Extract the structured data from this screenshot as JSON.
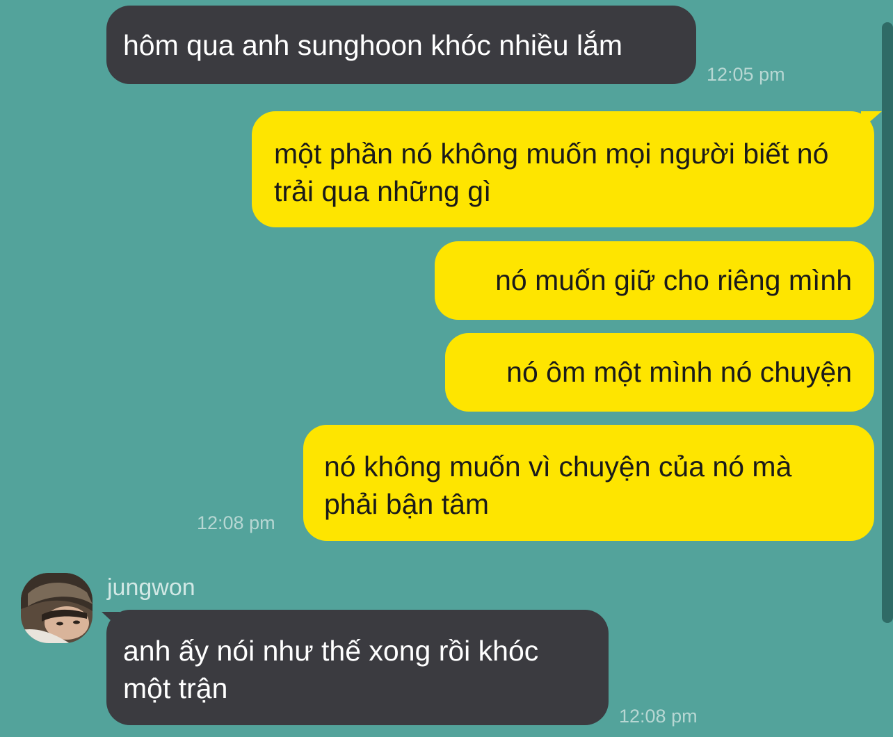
{
  "messages": [
    {
      "text": "hôm qua anh sunghoon khóc nhiều lắm",
      "side": "received",
      "time": "12:05 pm"
    },
    {
      "text": "một phần nó không muốn mọi người biết nó trải qua những gì",
      "side": "sent"
    },
    {
      "text": "nó muốn giữ cho riêng mình",
      "side": "sent"
    },
    {
      "text": "nó ôm một mình nó chuyện",
      "side": "sent"
    },
    {
      "text": "nó không muốn vì chuyện của nó mà phải bận tâm",
      "side": "sent",
      "time": "12:08 pm"
    },
    {
      "sender": "jungwon",
      "text": "anh ấy nói như thế xong rồi khóc một trận",
      "side": "received",
      "time": "12:08 pm"
    }
  ],
  "colors": {
    "background": "#53a39b",
    "received_bubble": "#3b3b40",
    "sent_bubble": "#fee500"
  }
}
